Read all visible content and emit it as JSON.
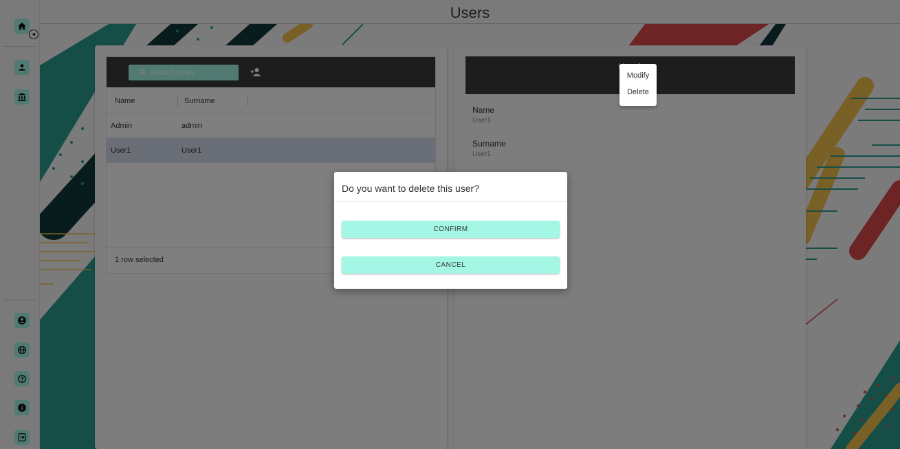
{
  "header": {
    "title": "Users"
  },
  "colors": {
    "accent": "#a3f7e4",
    "toolbar": "#3b3b3b",
    "teal": "#2a9d8f",
    "navy": "#10393b",
    "yellow": "#f2c14e",
    "red": "#d94848",
    "selected_row": "#d5dcef"
  },
  "sidebar": {
    "top": [
      {
        "icon": "home-icon"
      },
      {
        "icon": "user-icon"
      },
      {
        "icon": "bank-icon"
      }
    ],
    "bottom": [
      {
        "icon": "account-circle-icon"
      },
      {
        "icon": "globe-icon"
      },
      {
        "icon": "help-icon"
      },
      {
        "icon": "info-icon"
      },
      {
        "icon": "logout-icon"
      }
    ],
    "expand_icon": "arrow-right-circle-icon"
  },
  "users_grid": {
    "search_placeholder": "Search users",
    "columns": [
      "Name",
      "Surname"
    ],
    "rows": [
      {
        "name": "Admin",
        "surname": "admin"
      },
      {
        "name": "User1",
        "surname": "User1"
      }
    ],
    "footer": "1 row selected"
  },
  "detail": {
    "title": "User1",
    "fields": [
      {
        "label": "Name",
        "value": "User1"
      },
      {
        "label": "Surname",
        "value": "User1"
      }
    ]
  },
  "context_menu": {
    "items": [
      "Modify",
      "Delete"
    ]
  },
  "dialog": {
    "title": "Do you want to delete this user?",
    "confirm_label": "CONFIRM",
    "cancel_label": "CANCEL"
  }
}
